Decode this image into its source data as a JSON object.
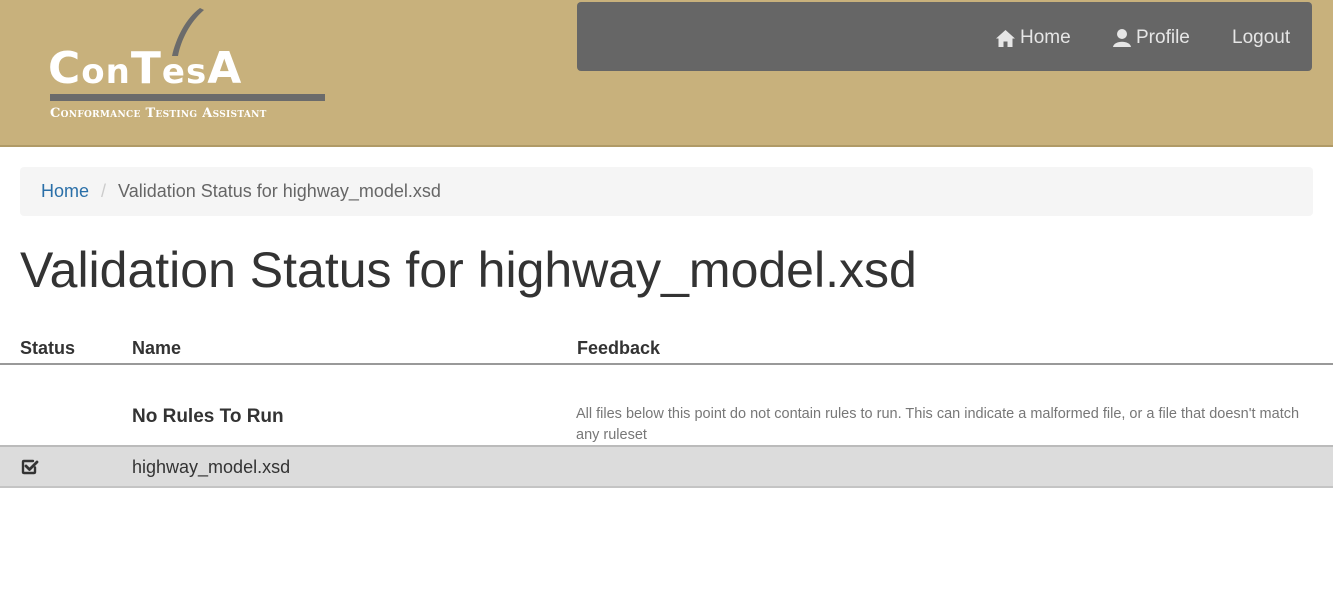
{
  "logo": {
    "word_c": "C",
    "word_on": "on",
    "word_t": "T",
    "word_es": "es",
    "word_a": "A",
    "tagline": "Conformance Testing Assistant"
  },
  "nav": {
    "home_label": "Home",
    "profile_label": "Profile",
    "logout_label": "Logout"
  },
  "breadcrumb": {
    "home": "Home",
    "separator": "/",
    "current": "Validation Status for highway_model.xsd"
  },
  "page": {
    "title": "Validation Status for highway_model.xsd"
  },
  "table": {
    "headers": {
      "status": "Status",
      "name": "Name",
      "feedback": "Feedback"
    },
    "rules_section": {
      "name": "No Rules To Run",
      "feedback": "All files below this point do not contain rules to run. This can indicate a malformed file, or a file that doesn't match any ruleset"
    },
    "rows": [
      {
        "status_icon": "check-square-icon",
        "name": "highway_model.xsd",
        "feedback": ""
      }
    ]
  },
  "colors": {
    "header_bg": "#c8b17c",
    "navbar_bg": "#666666",
    "link": "#2a6fa8",
    "row_bg": "#dcdcdc"
  }
}
